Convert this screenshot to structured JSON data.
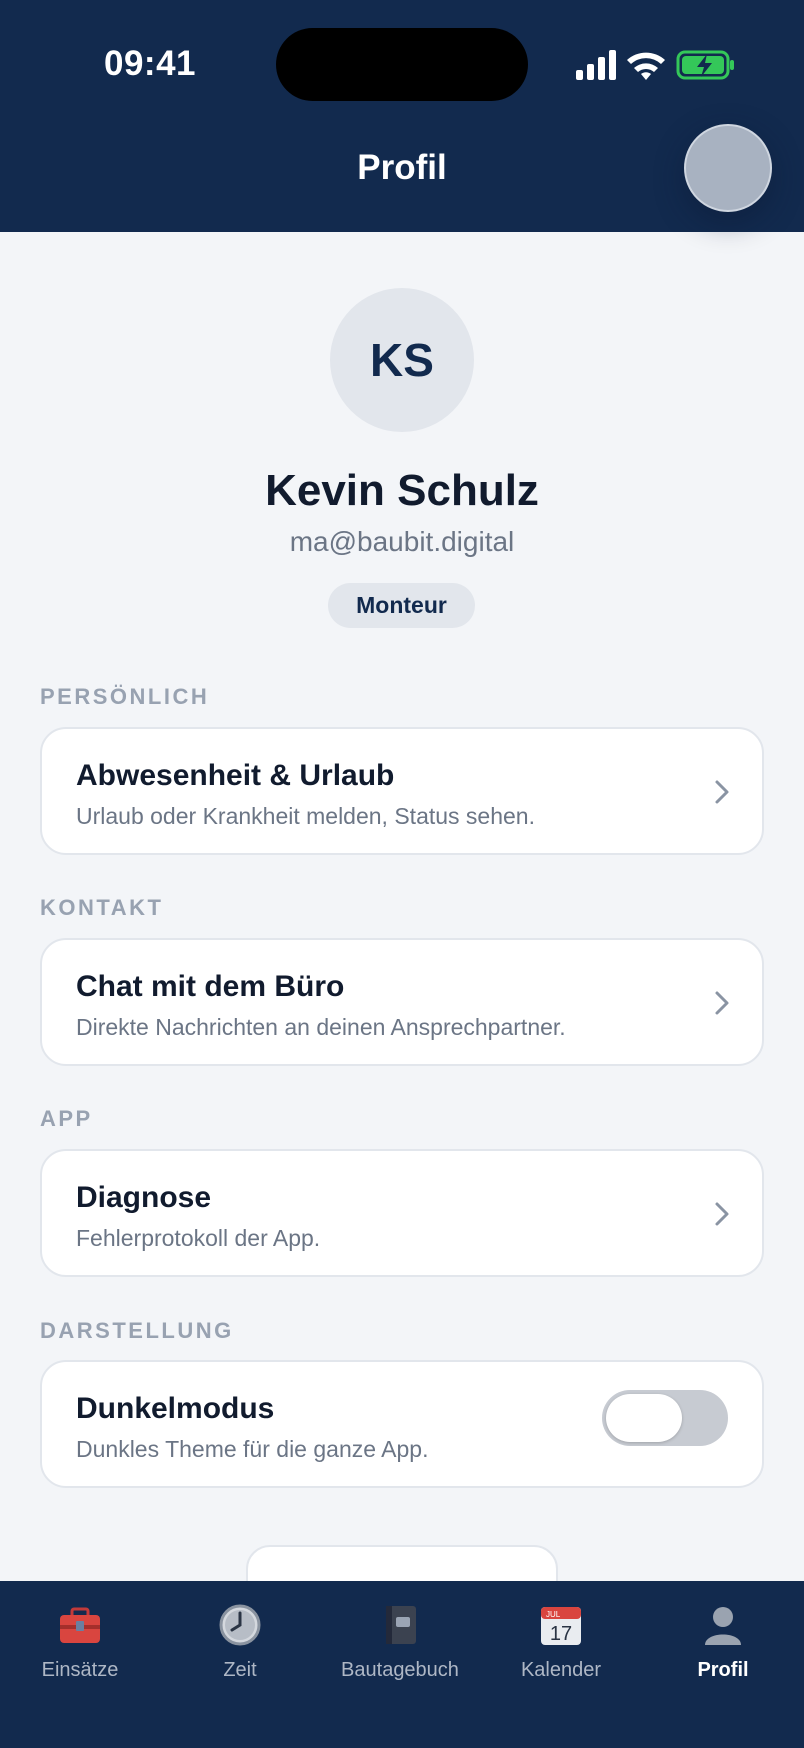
{
  "status_bar": {
    "time": "09:41"
  },
  "header": {
    "title": "Profil"
  },
  "profile": {
    "initials": "KS",
    "name": "Kevin Schulz",
    "email": "ma@baubit.digital",
    "role": "Monteur"
  },
  "sections": {
    "personal": {
      "label": "PERSÖNLICH",
      "item": {
        "title": "Abwesenheit & Urlaub",
        "subtitle": "Urlaub oder Krankheit melden, Status sehen."
      }
    },
    "contact": {
      "label": "KONTAKT",
      "item": {
        "title": "Chat mit dem Büro",
        "subtitle": "Direkte Nachrichten an deinen Ansprechpartner."
      }
    },
    "app": {
      "label": "APP",
      "item": {
        "title": "Diagnose",
        "subtitle": "Fehlerprotokoll der App."
      }
    },
    "appearance": {
      "label": "DARSTELLUNG",
      "item": {
        "title": "Dunkelmodus",
        "subtitle": "Dunkles Theme für die ganze App.",
        "enabled": false
      }
    }
  },
  "tabbar": {
    "items": [
      {
        "label": "Einsätze",
        "icon": "toolbox-icon"
      },
      {
        "label": "Zeit",
        "icon": "clock-icon"
      },
      {
        "label": "Bautagebuch",
        "icon": "notebook-icon"
      },
      {
        "label": "Kalender",
        "icon": "calendar-icon",
        "calendar_day": "17",
        "calendar_month": "JUL"
      },
      {
        "label": "Profil",
        "icon": "person-icon",
        "active": true
      }
    ]
  },
  "colors": {
    "header": "#122a4e",
    "background": "#f3f5f8",
    "battery": "#34c759"
  }
}
